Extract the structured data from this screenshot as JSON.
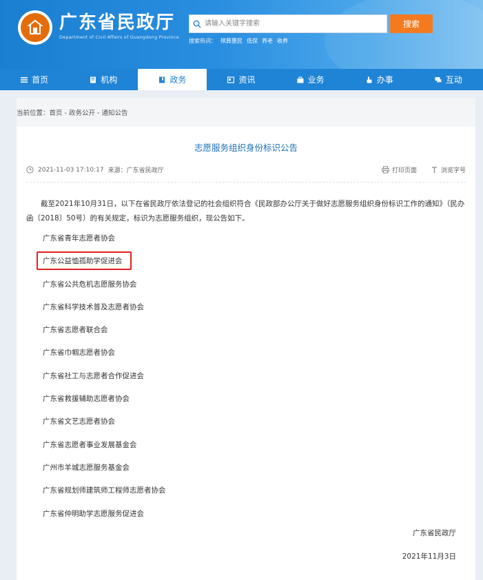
{
  "header": {
    "title": "广东省民政厅",
    "subtitle": "Department of Civil Affairs of Guangdong Province",
    "search_placeholder": "请输入关键字搜索",
    "search_button": "搜索",
    "hot_label": "搜索热词：",
    "hot_words": [
      "殡葬惠民",
      "低保",
      "养老",
      "收养"
    ]
  },
  "nav": {
    "items": [
      {
        "label": "首页",
        "icon": "list-icon"
      },
      {
        "label": "机构",
        "icon": "building-icon"
      },
      {
        "label": "政务",
        "icon": "book-icon"
      },
      {
        "label": "资讯",
        "icon": "news-icon"
      },
      {
        "label": "业务",
        "icon": "briefcase-icon"
      },
      {
        "label": "办事",
        "icon": "hand-icon"
      },
      {
        "label": "互动",
        "icon": "chat-icon"
      }
    ],
    "active_index": 2
  },
  "breadcrumb": {
    "prefix": "当前位置：",
    "path": "首页 - 政务公开 - 通知公告"
  },
  "article": {
    "title": "志愿服务组织身份标识公告",
    "datetime": "2021-11-03 17:10:17",
    "source": "来源：广东省民政厅",
    "print": "打印页面",
    "font_size": "浏览字号",
    "intro": "截至2021年10月31日，以下在省民政厅依法登记的社会组织符合《民政部办公厅关于做好志愿服务组织身份标识工作的通知》（民办函〔2018〕50号）的有关规定，标识为志愿服务组织，现公告如下。",
    "organizations": [
      "广东省青年志愿者协会",
      "广东公益恤孤助学促进会",
      "广东省公共危机志愿服务协会",
      "广东省科学技术普及志愿者协会",
      "广东省志愿者联合会",
      "广东省巾帼志愿者协会",
      "广东省社工与志愿者合作促进会",
      "广东省救援辅助志愿者协会",
      "广东省文艺志愿者协会",
      "广东省志愿者事业发展基金会",
      "广州市羊城志愿服务基金会",
      "广东省规划师建筑师工程师志愿者协会",
      "广东省仲明助学志愿服务促进会"
    ],
    "highlighted_index": 1,
    "signature": "广东省民政厅",
    "sign_date": "2021年11月3日"
  },
  "colors": {
    "header_blue": "#1a7fd0",
    "nav_blue": "#1f84d6",
    "search_orange": "#f47a1f",
    "title_blue": "#1a6fb8",
    "highlight_red": "#e02020"
  }
}
